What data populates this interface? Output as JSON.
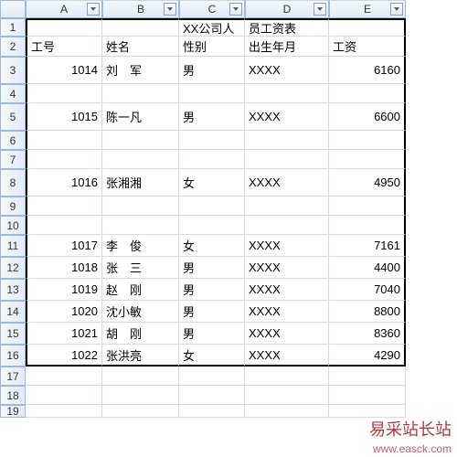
{
  "columns": [
    "A",
    "B",
    "C",
    "D",
    "E"
  ],
  "row_numbers": [
    1,
    2,
    3,
    4,
    5,
    6,
    7,
    8,
    9,
    10,
    11,
    12,
    13,
    14,
    15,
    16,
    17,
    18,
    19
  ],
  "header_row": {
    "c": "XX公司人",
    "d": "员工资表"
  },
  "title_row": {
    "a": "工号",
    "b": "姓名",
    "c": "性别",
    "d": "出生年月",
    "e": "工资"
  },
  "rows": [
    {
      "r": 3,
      "a": "1014",
      "b": "刘　军",
      "c": "男",
      "d": "XXXX",
      "e": "6160"
    },
    {
      "r": 5,
      "a": "1015",
      "b": "陈一凡",
      "c": "男",
      "d": "XXXX",
      "e": "6600"
    },
    {
      "r": 8,
      "a": "1016",
      "b": "张湘湘",
      "c": "女",
      "d": "XXXX",
      "e": "4950"
    },
    {
      "r": 11,
      "a": "1017",
      "b": "李　俊",
      "c": "女",
      "d": "XXXX",
      "e": "7161"
    },
    {
      "r": 12,
      "a": "1018",
      "b": "张　三",
      "c": "男",
      "d": "XXXX",
      "e": "4400"
    },
    {
      "r": 13,
      "a": "1019",
      "b": "赵　刚",
      "c": "男",
      "d": "XXXX",
      "e": "7040"
    },
    {
      "r": 14,
      "a": "1020",
      "b": "沈小敏",
      "c": "男",
      "d": "XXXX",
      "e": "8800"
    },
    {
      "r": 15,
      "a": "1021",
      "b": "胡　刚",
      "c": "男",
      "d": "XXXX",
      "e": "8360"
    },
    {
      "r": 16,
      "a": "1022",
      "b": "张洪亮",
      "c": "女",
      "d": "XXXX",
      "e": "4290"
    }
  ],
  "row_heights": {
    "1": 20,
    "2": 22,
    "3": 30,
    "4": 21,
    "5": 30,
    "6": 21,
    "7": 21,
    "8": 30,
    "9": 21,
    "10": 21,
    "11": 24,
    "12": 24,
    "13": 24,
    "14": 24,
    "15": 24,
    "16": 24,
    "17": 21,
    "18": 21,
    "19": 14
  },
  "watermark": {
    "text": "易采站长站",
    "url": "www.easck.com"
  }
}
